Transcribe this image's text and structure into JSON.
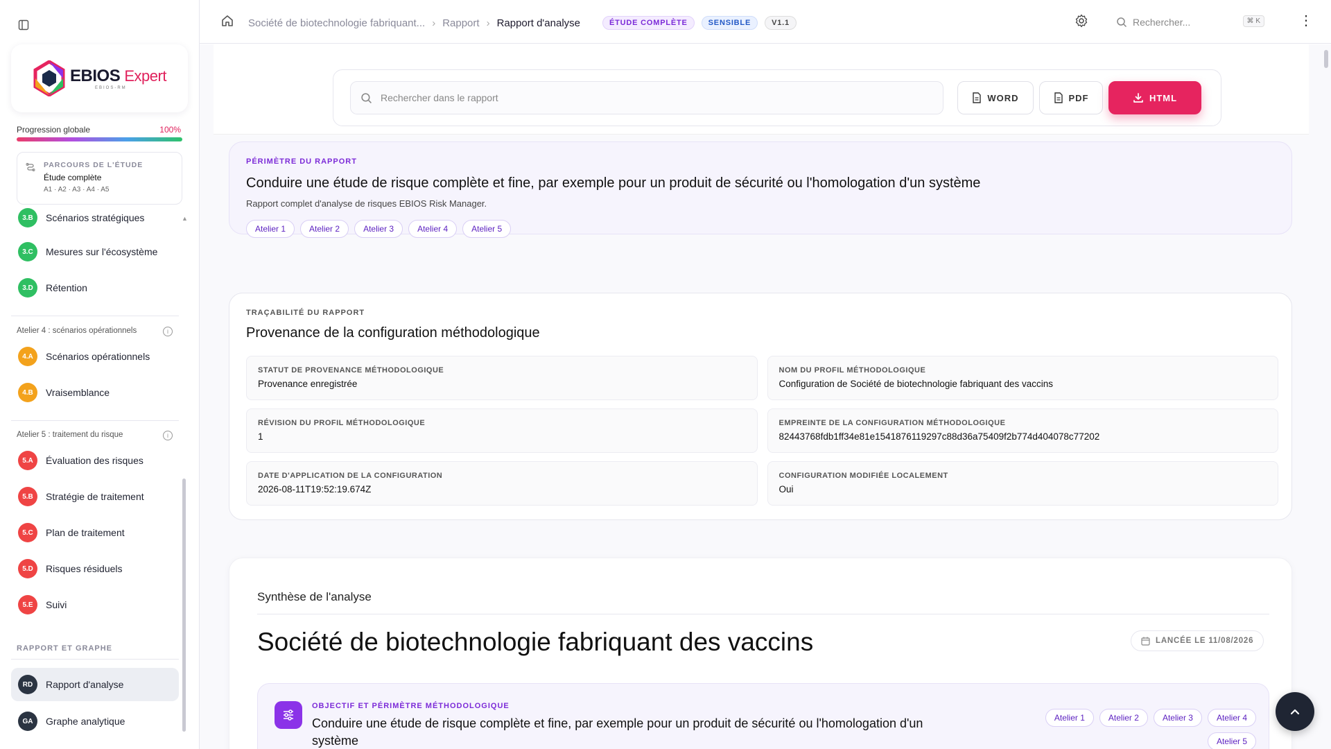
{
  "sidebar": {
    "logo": {
      "brand": "EBIOS",
      "suffix": "Expert",
      "sub": "EBIOS-RM"
    },
    "progress": {
      "label": "Progression globale",
      "value": "100%"
    },
    "path": {
      "title": "PARCOURS DE L'ÉTUDE",
      "name": "Étude complète",
      "steps": "A1 · A2 · A3 · A4 · A5"
    },
    "partial_item": {
      "code": "3.B",
      "label": "Scénarios stratégiques"
    },
    "atelier3_items": [
      {
        "code": "3.C",
        "label": "Mesures sur l'écosystème"
      },
      {
        "code": "3.D",
        "label": "Rétention"
      }
    ],
    "atelier4": {
      "label": "Atelier 4 : scénarios opérationnels",
      "items": [
        {
          "code": "4.A",
          "label": "Scénarios opérationnels"
        },
        {
          "code": "4.B",
          "label": "Vraisemblance"
        }
      ]
    },
    "atelier5": {
      "label": "Atelier 5 : traitement du risque",
      "items": [
        {
          "code": "5.A",
          "label": "Évaluation des risques"
        },
        {
          "code": "5.B",
          "label": "Stratégie de traitement"
        },
        {
          "code": "5.C",
          "label": "Plan de traitement"
        },
        {
          "code": "5.D",
          "label": "Risques résiduels"
        },
        {
          "code": "5.E",
          "label": "Suivi"
        }
      ]
    },
    "report": {
      "label": "RAPPORT ET GRAPHE",
      "items": [
        {
          "code": "RD",
          "label": "Rapport d'analyse"
        },
        {
          "code": "GA",
          "label": "Graphe analytique"
        }
      ]
    }
  },
  "header": {
    "breadcrumb": [
      "Société de biotechnologie fabriquant...",
      "Rapport",
      "Rapport d'analyse"
    ],
    "pills": [
      "ÉTUDE COMPLÈTE",
      "SENSIBLE",
      "V1.1"
    ],
    "search_placeholder": "Rechercher...",
    "shortcut": "⌘ K"
  },
  "toolbar": {
    "search_placeholder": "Rechercher dans le rapport",
    "word": "WORD",
    "pdf": "PDF",
    "html": "HTML"
  },
  "scope": {
    "kicker": "PÉRIMÈTRE DU RAPPORT",
    "title": "Conduire une étude de risque complète et fine, par exemple pour un produit de sécurité ou l'homologation d'un système",
    "subtitle": "Rapport complet d'analyse de risques EBIOS Risk Manager.",
    "chips": [
      "Atelier 1",
      "Atelier 2",
      "Atelier 3",
      "Atelier 4",
      "Atelier 5"
    ]
  },
  "trace": {
    "kicker": "TRAÇABILITÉ DU RAPPORT",
    "title": "Provenance de la configuration méthodologique",
    "fields": [
      {
        "key": "STATUT DE PROVENANCE MÉTHODOLOGIQUE",
        "value": "Provenance enregistrée"
      },
      {
        "key": "NOM DU PROFIL MÉTHODOLOGIQUE",
        "value": "Configuration de Société de biotechnologie fabriquant des vaccins"
      },
      {
        "key": "RÉVISION DU PROFIL MÉTHODOLOGIQUE",
        "value": "1"
      },
      {
        "key": "EMPREINTE DE LA CONFIGURATION MÉTHODOLOGIQUE",
        "value": "82443768fdb1ff34e81e1541876119297c88d36a75409f2b774d404078c77202"
      },
      {
        "key": "DATE D'APPLICATION DE LA CONFIGURATION",
        "value": "2026-08-11T19:52:19.674Z"
      },
      {
        "key": "CONFIGURATION MODIFIÉE LOCALEMENT",
        "value": "Oui"
      }
    ]
  },
  "synthesis": {
    "heading": "Synthèse de l'analyse",
    "title": "Société de biotechnologie fabriquant des vaccins",
    "date": "LANCÉE LE 11/08/2026",
    "objective": {
      "kicker": "OBJECTIF ET PÉRIMÈTRE MÉTHODOLOGIQUE",
      "text": "Conduire une étude de risque complète et fine, par exemple pour un produit de sécurité ou l'homologation d'un système",
      "chips": [
        "Atelier 1",
        "Atelier 2",
        "Atelier 3",
        "Atelier 4",
        "Atelier 5"
      ]
    }
  },
  "colors": {
    "accent": "#e6245f",
    "purple": "#7c2bd8",
    "green": "#2fbf62",
    "orange": "#f3a21c",
    "red": "#ef4444"
  }
}
